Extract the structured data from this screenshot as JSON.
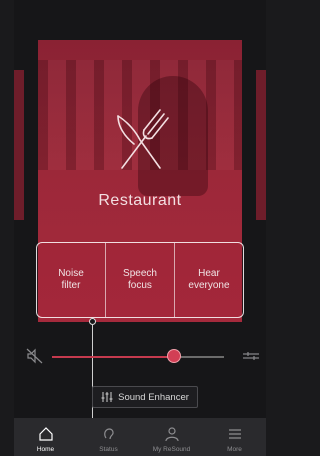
{
  "program": {
    "name": "Restaurant",
    "icon": "knife-fork-icon"
  },
  "focus_options": [
    {
      "label": "Noise\nfilter"
    },
    {
      "label": "Speech\nfocus"
    },
    {
      "label": "Hear\neveryone"
    }
  ],
  "volume": {
    "level_fraction": 0.75,
    "mute_icon": "speaker-mute-icon",
    "eq_icon": "equalizer-icon"
  },
  "sound_enhancer": {
    "label": "Sound Enhancer",
    "icon": "sliders-icon"
  },
  "tabs": [
    {
      "label": "Home",
      "icon": "home-icon",
      "active": true
    },
    {
      "label": "Status",
      "icon": "hearing-icon",
      "active": false
    },
    {
      "label": "My ReSound",
      "icon": "person-icon",
      "active": false
    },
    {
      "label": "More",
      "icon": "menu-icon",
      "active": false
    }
  ],
  "colors": {
    "accent": "#d23f55",
    "card": "#9c2839",
    "background": "#161618",
    "tabbar": "#2a2a2d"
  }
}
